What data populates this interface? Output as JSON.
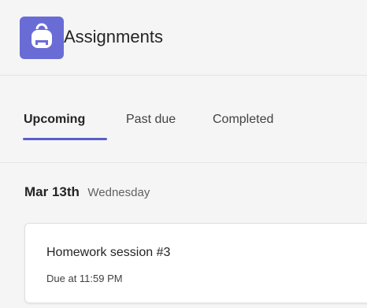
{
  "header": {
    "title": "Assignments",
    "icon": "backpack-icon",
    "icon_color": "#6a6cd6"
  },
  "tabs": [
    {
      "label": "Upcoming",
      "active": true
    },
    {
      "label": "Past due",
      "active": false
    },
    {
      "label": "Completed",
      "active": false
    }
  ],
  "accent_color": "#5b5fc7",
  "groups": [
    {
      "date": "Mar 13th",
      "weekday": "Wednesday",
      "items": [
        {
          "title": "Homework session #3",
          "due": "Due at 11:59 PM"
        }
      ]
    }
  ]
}
